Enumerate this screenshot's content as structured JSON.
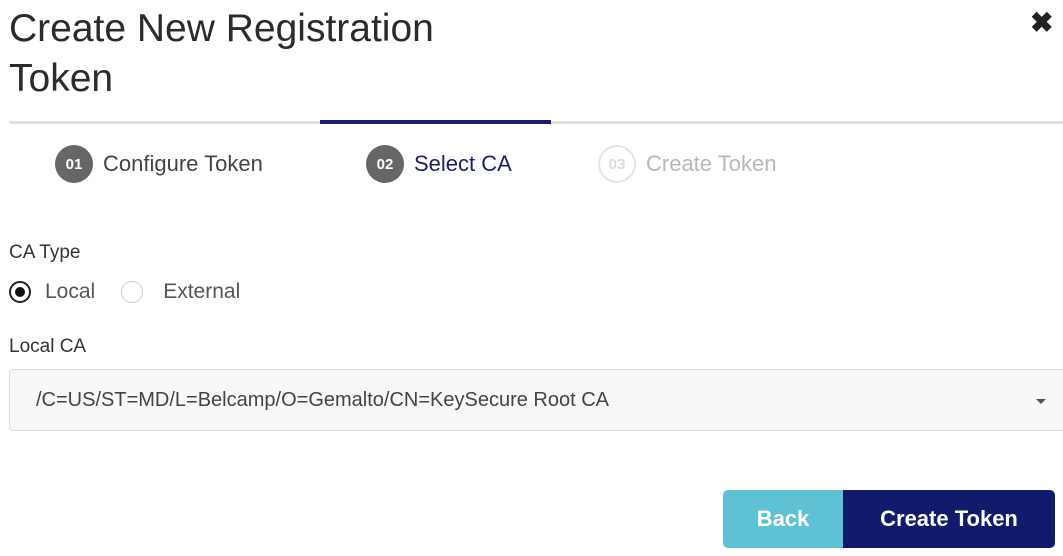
{
  "dialog": {
    "title": "Create New Registration Token",
    "close_icon": "close-x-icon"
  },
  "steps": [
    {
      "number": "01",
      "label": "Configure Token",
      "state": "done"
    },
    {
      "number": "02",
      "label": "Select CA",
      "state": "current"
    },
    {
      "number": "03",
      "label": "Create Token",
      "state": "pending"
    }
  ],
  "ca_type": {
    "label": "CA Type",
    "options": [
      "Local",
      "External"
    ],
    "selected": "Local"
  },
  "local_ca": {
    "label": "Local CA",
    "value": "/C=US/ST=MD/L=Belcamp/O=Gemalto/CN=KeySecure Root CA"
  },
  "buttons": {
    "back": "Back",
    "create": "Create Token"
  },
  "colors": {
    "primary": "#111a6b",
    "secondary": "#5fc2d4",
    "active_step": "#1b1f6b"
  }
}
